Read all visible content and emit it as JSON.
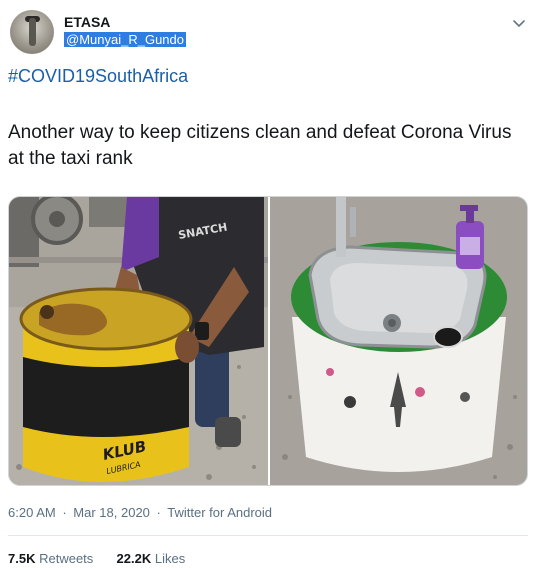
{
  "user": {
    "name": "ETASA",
    "handle": "@Munyai_R_Gundo"
  },
  "tweet": {
    "hashtag": "#COVID19SouthAfrica",
    "text": "Another way to keep citizens clean and defeat Corona Virus at the taxi rank",
    "drum_text_top": "KLUB",
    "drum_text_bottom": "LUBRICA"
  },
  "meta": {
    "time": "6:20 AM",
    "separator": "·",
    "date": "Mar 18, 2020",
    "source": "Twitter for Android"
  },
  "stats": {
    "retweets_count": "7.5K",
    "retweets_label": "Retweets",
    "likes_count": "22.2K",
    "likes_label": "Likes"
  },
  "icons": {
    "menu": "chevron-down-icon"
  },
  "colors": {
    "link": "#1b5fa8",
    "handle_highlight": "#2f7de1",
    "drum_yellow": "#e8c21b",
    "turf_green": "#2e8b35"
  }
}
